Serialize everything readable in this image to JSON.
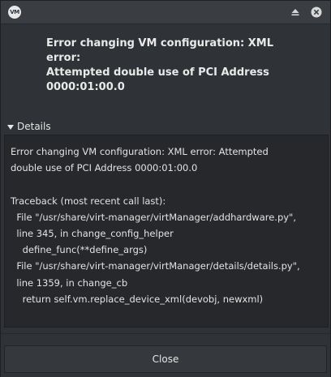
{
  "titlebar": {
    "app_icon_text": "VM",
    "icons": {
      "app": "virt-manager-icon",
      "minimize": "minimize-icon",
      "close": "close-icon"
    }
  },
  "dialog": {
    "message": "Error changing VM configuration: XML error:\nAttempted double use of PCI Address\n0000:01:00.0",
    "details_label": "Details",
    "details_expanded": true,
    "details_text": "Error changing VM configuration: XML error: Attempted\ndouble use of PCI Address 0000:01:00.0\n\nTraceback (most recent call last):\n  File \"/usr/share/virt-manager/virtManager/addhardware.py\",\n  line 345, in change_config_helper\n    define_func(**define_args)\n  File \"/usr/share/virt-manager/virtManager/details/details.py\",\n  line 1359, in change_cb\n    return self.vm.replace_device_xml(devobj, newxml)\n           ^^^^^^^^^^^^^^^^^^^^^^^^^^^^^^^^^^^^^^^^\n  File \"/usr/share/virt-manager/virtManager/object/",
    "close_label": "Close"
  },
  "colors": {
    "window_bg": "#2f3236",
    "titlebar_bg": "#3a3d41",
    "details_bg": "#26282b",
    "text": "#e6e6e6"
  }
}
